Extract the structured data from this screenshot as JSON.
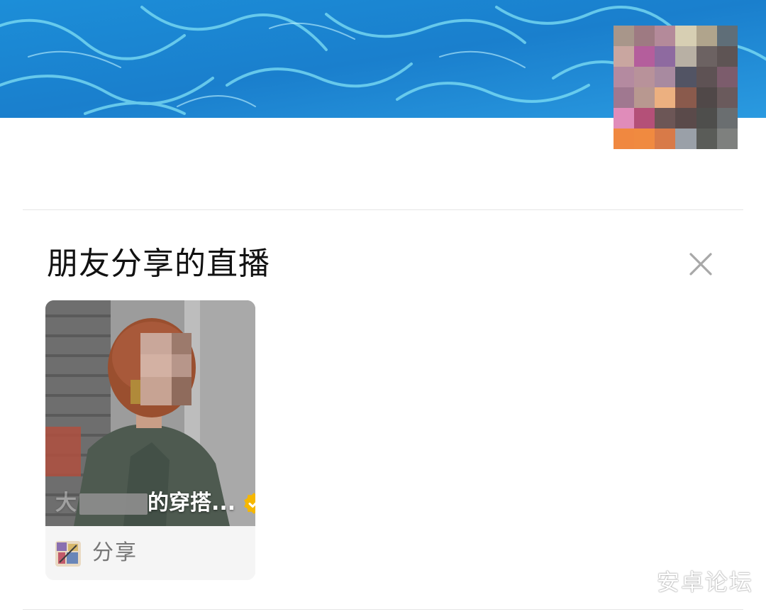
{
  "section": {
    "title": "朋友分享的直播"
  },
  "live_card": {
    "title_visible": "的穿搭...",
    "title_prefix": "大",
    "share_label": "分享"
  },
  "watermark": "安卓论坛",
  "icons": {
    "close": "close-icon",
    "verified": "verified-badge-icon",
    "share_thumb": "shared-live-thumbnail"
  },
  "colors": {
    "cover_water": "#1b8bd6",
    "verified_badge": "#f6b700",
    "divider": "#e6e6e6",
    "title_text": "#111111",
    "share_text": "#777777"
  }
}
